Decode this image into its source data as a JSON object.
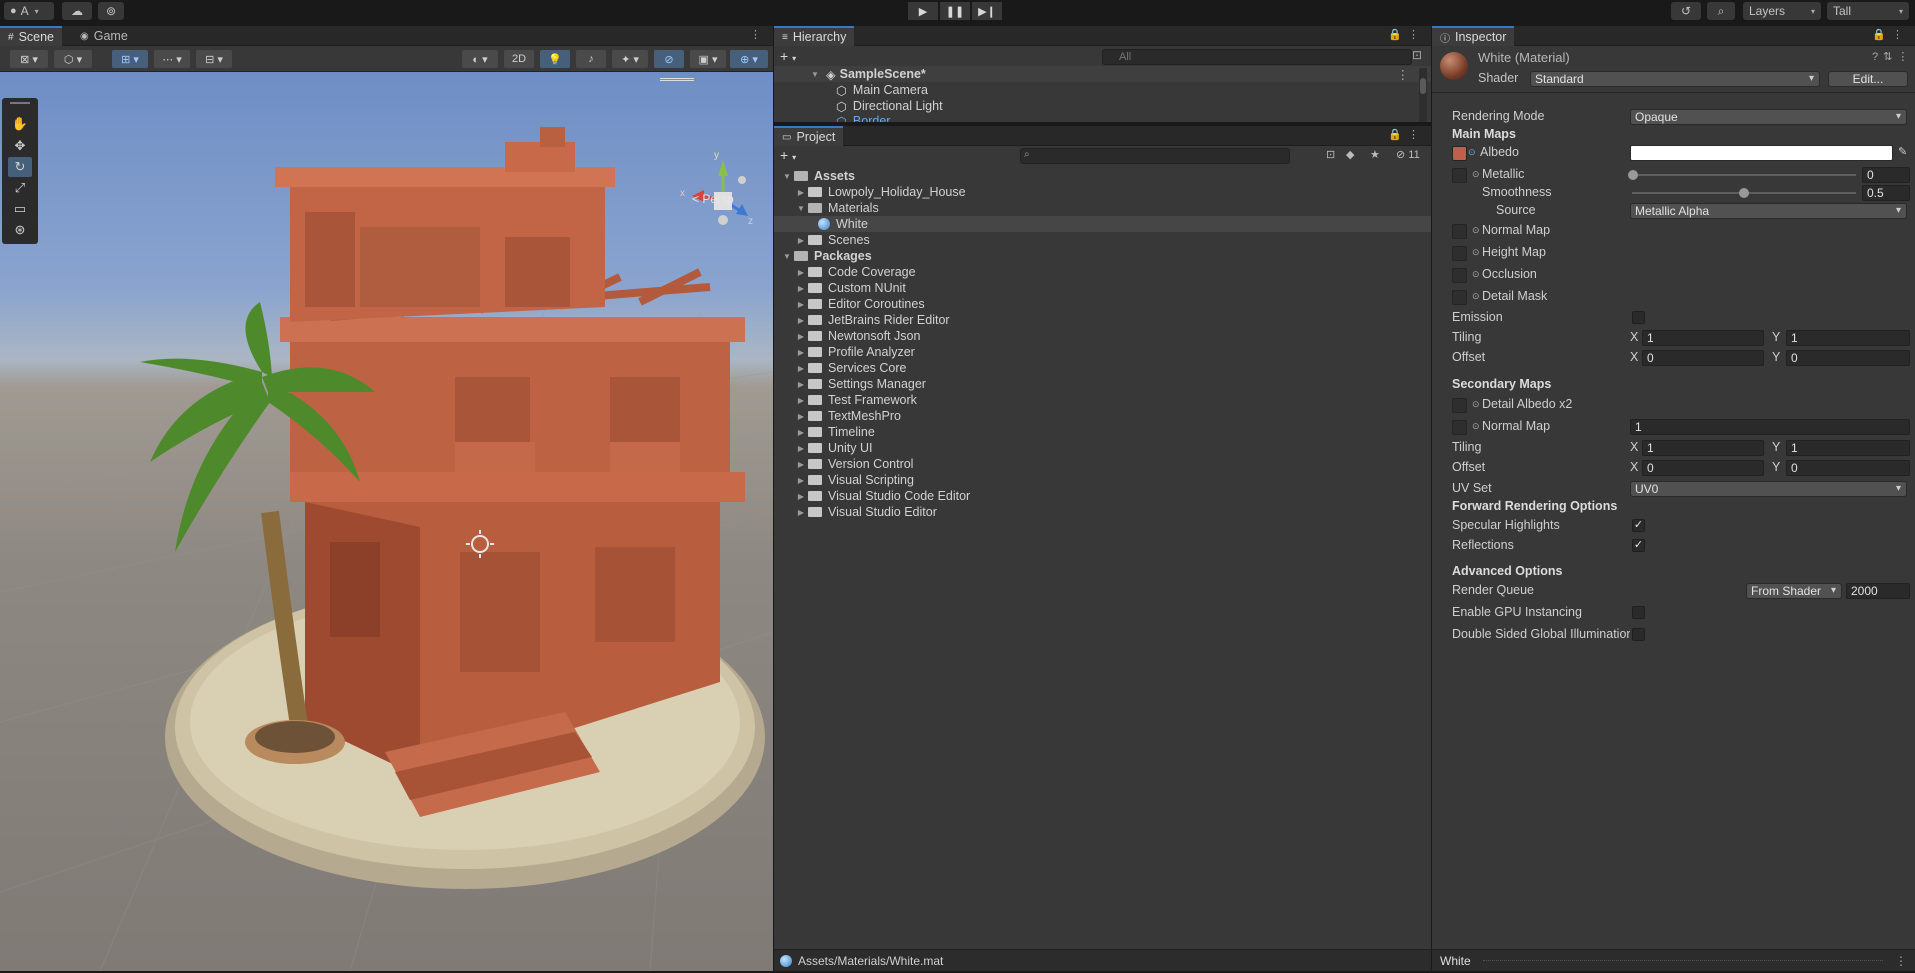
{
  "toolbar": {
    "account_label": "A",
    "layers_label": "Layers",
    "layout_label": "Tall"
  },
  "scene": {
    "tabs": [
      "Scene",
      "Game"
    ],
    "mode_2d": "2D",
    "persp_label": "< Persp",
    "axis_x": "x",
    "axis_y": "y",
    "axis_z": "z"
  },
  "hierarchy": {
    "tab": "Hierarchy",
    "search_placeholder": "All",
    "scene_name": "SampleScene*",
    "items": [
      "Main Camera",
      "Directional Light",
      "Border"
    ]
  },
  "project": {
    "tab": "Project",
    "hidden_count": "11",
    "root_assets": "Assets",
    "assets": [
      "Lowpoly_Holiday_House",
      "Materials",
      "White",
      "Scenes"
    ],
    "root_packages": "Packages",
    "packages": [
      "Code Coverage",
      "Custom NUnit",
      "Editor Coroutines",
      "JetBrains Rider Editor",
      "Newtonsoft Json",
      "Profile Analyzer",
      "Services Core",
      "Settings Manager",
      "Test Framework",
      "TextMeshPro",
      "Timeline",
      "Unity UI",
      "Version Control",
      "Visual Scripting",
      "Visual Studio Code Editor",
      "Visual Studio Editor"
    ],
    "status_path": "Assets/Materials/White.mat"
  },
  "inspector": {
    "tab": "Inspector",
    "title": "White (Material)",
    "shader_label": "Shader",
    "shader_value": "Standard",
    "edit_label": "Edit...",
    "rendering_mode_label": "Rendering Mode",
    "rendering_mode_value": "Opaque",
    "main_maps": "Main Maps",
    "albedo": "Albedo",
    "metallic": "Metallic",
    "metallic_value": "0",
    "smoothness": "Smoothness",
    "smoothness_value": "0.5",
    "source": "Source",
    "source_value": "Metallic Alpha",
    "normal_map": "Normal Map",
    "height_map": "Height Map",
    "occlusion": "Occlusion",
    "detail_mask": "Detail Mask",
    "emission": "Emission",
    "tiling": "Tiling",
    "offset": "Offset",
    "x": "X",
    "y": "Y",
    "tiling_x": "1",
    "tiling_y": "1",
    "offset_x": "0",
    "offset_y": "0",
    "secondary_maps": "Secondary Maps",
    "detail_albedo": "Detail Albedo x2",
    "normal_map2": "Normal Map",
    "normal_map2_value": "1",
    "tiling2_x": "1",
    "tiling2_y": "1",
    "offset2_x": "0",
    "offset2_y": "0",
    "uv_set": "UV Set",
    "uv_set_value": "UV0",
    "forward_rendering": "Forward Rendering Options",
    "specular_highlights": "Specular Highlights",
    "reflections": "Reflections",
    "advanced_options": "Advanced Options",
    "render_queue": "Render Queue",
    "render_queue_mode": "From Shader",
    "render_queue_value": "2000",
    "gpu_instancing": "Enable GPU Instancing",
    "double_sided_gi": "Double Sided Global Illumination",
    "bottom_label": "White"
  },
  "colors": {
    "albedo_swatch": "#c0604a",
    "accent": "#3a79bb"
  }
}
